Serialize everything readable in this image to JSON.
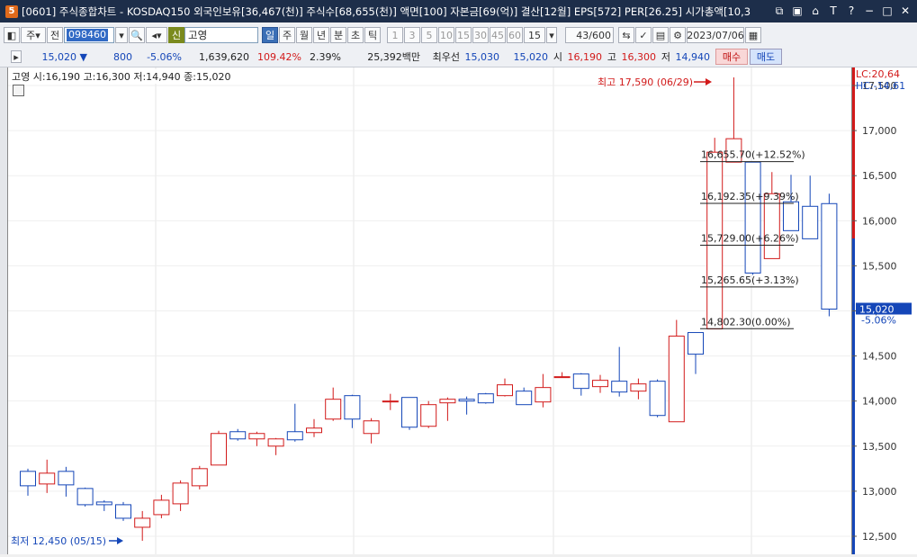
{
  "title_bar": {
    "app_badge": "5",
    "text": "[0601] 주식종합차트 - KOSDAQ150 외국인보유[36,467(천)] 주식수[68,655(천)] 액면[100] 자본금[69(억)] 결산[12월] EPS[572] PER[26.25] 시가총액[10,3",
    "icons": [
      "restore-windows-icon",
      "copy-icon",
      "lock-icon",
      "font-icon",
      "help-icon",
      "minimize-icon",
      "maximize-icon",
      "close-icon"
    ]
  },
  "toolbar": {
    "market_select": "주",
    "prev_label": "전",
    "code": "098460",
    "shin_badge": "신",
    "stock_name": "고영",
    "period_tabs": [
      "일",
      "주",
      "월",
      "년",
      "분",
      "초",
      "틱"
    ],
    "active_period": "일",
    "minute_options": [
      "1",
      "3",
      "5",
      "10",
      "15",
      "30",
      "45",
      "60"
    ],
    "custom_period": "15",
    "count": "43",
    "max_count": "/600",
    "date": "2023/07/06"
  },
  "quote": {
    "price": "15,020 ▼",
    "change": "800",
    "change_pct": "-5.06%",
    "volume": "1,639,620",
    "vol_ratio": "109.42%",
    "turnover": "2.39%",
    "amount": "25,392백만",
    "best_bid_label": "최우선",
    "ask": "15,030",
    "bid": "15,020",
    "open_label": "시",
    "open": "16,190",
    "high_label": "고",
    "high": "16,300",
    "low_label": "저",
    "low": "14,940",
    "buy_label": "매수",
    "sell_label": "매도"
  },
  "chart_info": "고영 시:16,190 고:16,300 저:14,940 종:15,020",
  "annotations": {
    "max": "최고 17,590 (06/29)",
    "min": "최저 12,450 (05/15)",
    "lc": "LC:20,64",
    "hc": "HC:-14,61",
    "last_price": "15,020",
    "last_pct": "-5.06%"
  },
  "colors": {
    "up": "#d21a1a",
    "down": "#1446b8",
    "title_bg": "#1d2e4a"
  },
  "chart_data": {
    "type": "candlestick",
    "y_ticks": [
      17500,
      17000,
      16500,
      16000,
      15500,
      15000,
      14500,
      14000,
      13500,
      13000,
      12500
    ],
    "y_tick_labels": [
      "17,500",
      "17,000",
      "16,500",
      "16,000",
      "15,500",
      "15,000",
      "14,500",
      "14,000",
      "13,500",
      "13,000",
      "12,500"
    ],
    "ylim": [
      12300,
      17700
    ],
    "candles": [
      {
        "o": 13220,
        "h": 13250,
        "l": 12950,
        "c": 13060
      },
      {
        "o": 13080,
        "h": 13350,
        "l": 12980,
        "c": 13200
      },
      {
        "o": 13220,
        "h": 13270,
        "l": 12940,
        "c": 13070
      },
      {
        "o": 13030,
        "h": 13040,
        "l": 12830,
        "c": 12850
      },
      {
        "o": 12880,
        "h": 12900,
        "l": 12780,
        "c": 12850
      },
      {
        "o": 12850,
        "h": 12880,
        "l": 12670,
        "c": 12700
      },
      {
        "o": 12600,
        "h": 12780,
        "l": 12450,
        "c": 12700
      },
      {
        "o": 12740,
        "h": 12960,
        "l": 12700,
        "c": 12900
      },
      {
        "o": 12860,
        "h": 13120,
        "l": 12780,
        "c": 13090
      },
      {
        "o": 13060,
        "h": 13280,
        "l": 13020,
        "c": 13250
      },
      {
        "o": 13290,
        "h": 13670,
        "l": 13290,
        "c": 13640
      },
      {
        "o": 13660,
        "h": 13690,
        "l": 13560,
        "c": 13580
      },
      {
        "o": 13580,
        "h": 13660,
        "l": 13500,
        "c": 13640
      },
      {
        "o": 13500,
        "h": 13590,
        "l": 13400,
        "c": 13580
      },
      {
        "o": 13660,
        "h": 13970,
        "l": 13550,
        "c": 13570
      },
      {
        "o": 13650,
        "h": 13800,
        "l": 13600,
        "c": 13700
      },
      {
        "o": 13800,
        "h": 14150,
        "l": 13780,
        "c": 14020
      },
      {
        "o": 14060,
        "h": 14070,
        "l": 13700,
        "c": 13800
      },
      {
        "o": 13640,
        "h": 13810,
        "l": 13530,
        "c": 13780
      },
      {
        "o": 14000,
        "h": 14080,
        "l": 13900,
        "c": 14000
      },
      {
        "o": 14040,
        "h": 14040,
        "l": 13680,
        "c": 13710
      },
      {
        "o": 13720,
        "h": 14000,
        "l": 13700,
        "c": 13960
      },
      {
        "o": 13980,
        "h": 14040,
        "l": 13780,
        "c": 14020
      },
      {
        "o": 14020,
        "h": 14050,
        "l": 13850,
        "c": 14000
      },
      {
        "o": 14080,
        "h": 14090,
        "l": 13970,
        "c": 13980
      },
      {
        "o": 14060,
        "h": 14250,
        "l": 14050,
        "c": 14180
      },
      {
        "o": 14110,
        "h": 14150,
        "l": 13960,
        "c": 13960
      },
      {
        "o": 13990,
        "h": 14300,
        "l": 13930,
        "c": 14150
      },
      {
        "o": 14260,
        "h": 14320,
        "l": 14260,
        "c": 14270
      },
      {
        "o": 14300,
        "h": 14310,
        "l": 14060,
        "c": 14140
      },
      {
        "o": 14160,
        "h": 14290,
        "l": 14090,
        "c": 14230
      },
      {
        "o": 14220,
        "h": 14600,
        "l": 14050,
        "c": 14100
      },
      {
        "o": 14110,
        "h": 14250,
        "l": 14020,
        "c": 14190
      },
      {
        "o": 14220,
        "h": 14240,
        "l": 13820,
        "c": 13840
      },
      {
        "o": 13770,
        "h": 14900,
        "l": 13770,
        "c": 14720
      },
      {
        "o": 14760,
        "h": 14760,
        "l": 14300,
        "c": 14520
      },
      {
        "o": 14800,
        "h": 16920,
        "l": 14800,
        "c": 16760
      },
      {
        "o": 16650,
        "h": 17590,
        "l": 16650,
        "c": 16910
      },
      {
        "o": 16650,
        "h": 16650,
        "l": 15400,
        "c": 15420
      },
      {
        "o": 15580,
        "h": 16540,
        "l": 15580,
        "c": 16300
      },
      {
        "o": 16210,
        "h": 16510,
        "l": 15890,
        "c": 15890
      },
      {
        "o": 16160,
        "h": 16500,
        "l": 15800,
        "c": 15800
      },
      {
        "o": 16190,
        "h": 16300,
        "l": 14940,
        "c": 15020
      }
    ],
    "fib_levels": [
      {
        "value": 16655.7,
        "label": "16,655.70(+12.52%)"
      },
      {
        "value": 16192.35,
        "label": "16,192.35(+9.39%)"
      },
      {
        "value": 15729.0,
        "label": "15,729.00(+6.26%)"
      },
      {
        "value": 15265.65,
        "label": "15,265.65(+3.13%)"
      },
      {
        "value": 14802.3,
        "label": "14,802.30(0.00%)"
      }
    ]
  }
}
